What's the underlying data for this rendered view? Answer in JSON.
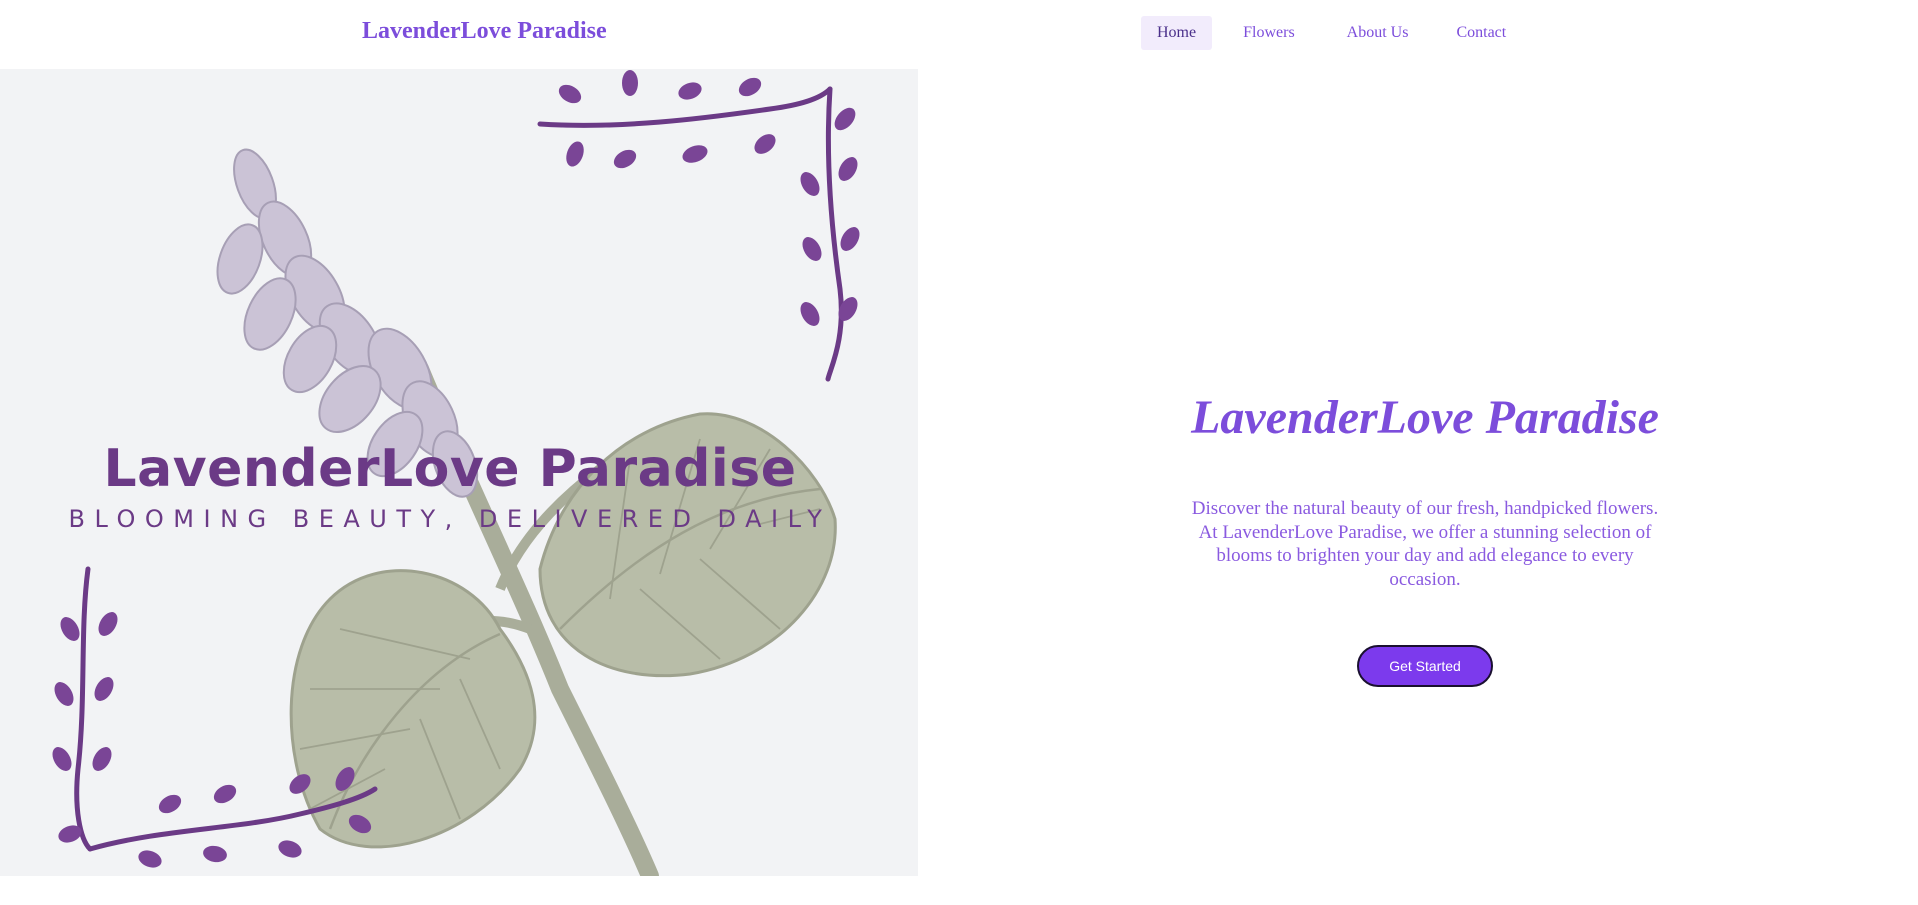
{
  "header": {
    "brand": "LavenderLove Paradise",
    "nav": [
      {
        "label": "Home",
        "active": true
      },
      {
        "label": "Flowers",
        "active": false
      },
      {
        "label": "About Us",
        "active": false
      },
      {
        "label": "Contact",
        "active": false
      }
    ]
  },
  "hero_image": {
    "logo_title": "LavenderLove Paradise",
    "logo_tagline": "BLOOMING BEAUTY, DELIVERED DAILY"
  },
  "hero": {
    "title": "LavenderLove Paradise",
    "text": "Discover the natural beauty of our fresh, handpicked flowers. At LavenderLove Paradise, we offer a stunning selection of blooms to brighten your day and add elegance to every occasion.",
    "cta_label": "Get Started"
  },
  "colors": {
    "accent": "#7c4ddb",
    "button": "#7c3aed",
    "nav_active_bg": "#f2ecfc",
    "logo_purple": "#6b3a86",
    "image_bg": "#f2f3f5"
  }
}
